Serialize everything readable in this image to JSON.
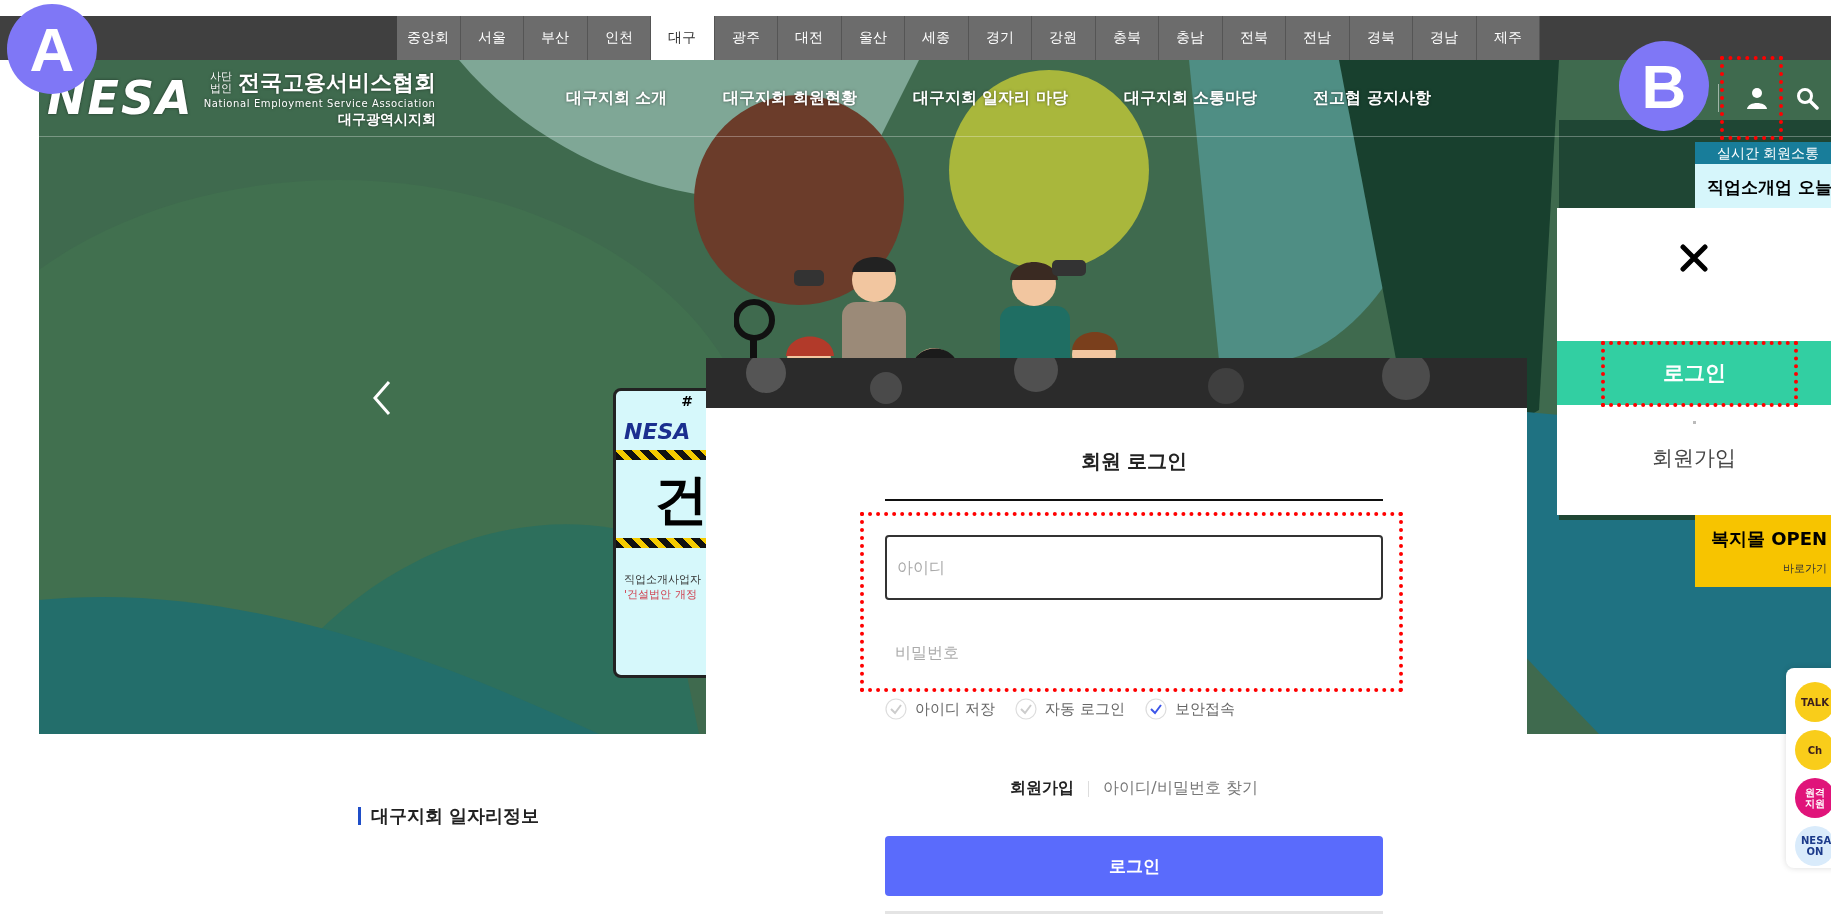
{
  "region_tabs": [
    {
      "label": "중앙회",
      "selected": false
    },
    {
      "label": "서울",
      "selected": false
    },
    {
      "label": "부산",
      "selected": false
    },
    {
      "label": "인천",
      "selected": false
    },
    {
      "label": "대구",
      "selected": true
    },
    {
      "label": "광주",
      "selected": false
    },
    {
      "label": "대전",
      "selected": false
    },
    {
      "label": "울산",
      "selected": false
    },
    {
      "label": "세종",
      "selected": false
    },
    {
      "label": "경기",
      "selected": false
    },
    {
      "label": "강원",
      "selected": false
    },
    {
      "label": "충북",
      "selected": false
    },
    {
      "label": "충남",
      "selected": false
    },
    {
      "label": "전북",
      "selected": false
    },
    {
      "label": "전남",
      "selected": false
    },
    {
      "label": "경북",
      "selected": false
    },
    {
      "label": "경남",
      "selected": false
    },
    {
      "label": "제주",
      "selected": false
    }
  ],
  "markers": [
    "A",
    "B"
  ],
  "logo": {
    "mark": "NESA",
    "corp_type": [
      "사단",
      "법인"
    ],
    "name": "전국고용서비스협회",
    "english": "National Employment Service Association",
    "branch": "대구광역시지회"
  },
  "nav": [
    "대구지회 소개",
    "대구지회 회원현황",
    "대구지회 일자리 마당",
    "대구지회 소통마당",
    "전고협 공지사항"
  ],
  "poster": {
    "tag": "#",
    "logo": "NESA",
    "headline": "건",
    "lines": [
      {
        "text": "직업소개사업자",
        "kind": "plain"
      },
      {
        "text": "'건설법안 개정",
        "kind": "highlight"
      }
    ]
  },
  "banner": {
    "header": "실시간 회원소통",
    "headline": "직업소개업 오늘",
    "promo": "복지몰 OPEN",
    "link": "바로가기"
  },
  "user_menu": {
    "items": [
      {
        "label": "로그인",
        "selected": true
      },
      {
        "label": "회원가입",
        "selected": false
      }
    ]
  },
  "login": {
    "title": "회원 로그인",
    "id_placeholder": "아이디",
    "password_placeholder": "비밀번호",
    "options": [
      {
        "label": "아이디 저장",
        "checked": false
      },
      {
        "label": "자동 로그인",
        "checked": false
      },
      {
        "label": "보안접속",
        "checked": true
      }
    ],
    "links": [
      {
        "label": "회원가입",
        "kind": "primary"
      },
      {
        "label": "아이디/비밀번호 찾기",
        "kind": "secondary"
      }
    ],
    "submit": "로그인"
  },
  "section_title": "대구지회 일자리정보",
  "quick_menu": [
    {
      "kind": "talk",
      "label": "TALK"
    },
    {
      "kind": "channel",
      "label": "Ch"
    },
    {
      "kind": "remote",
      "label": "원격 지원"
    },
    {
      "kind": "nesa",
      "label": "NESA ON"
    }
  ]
}
